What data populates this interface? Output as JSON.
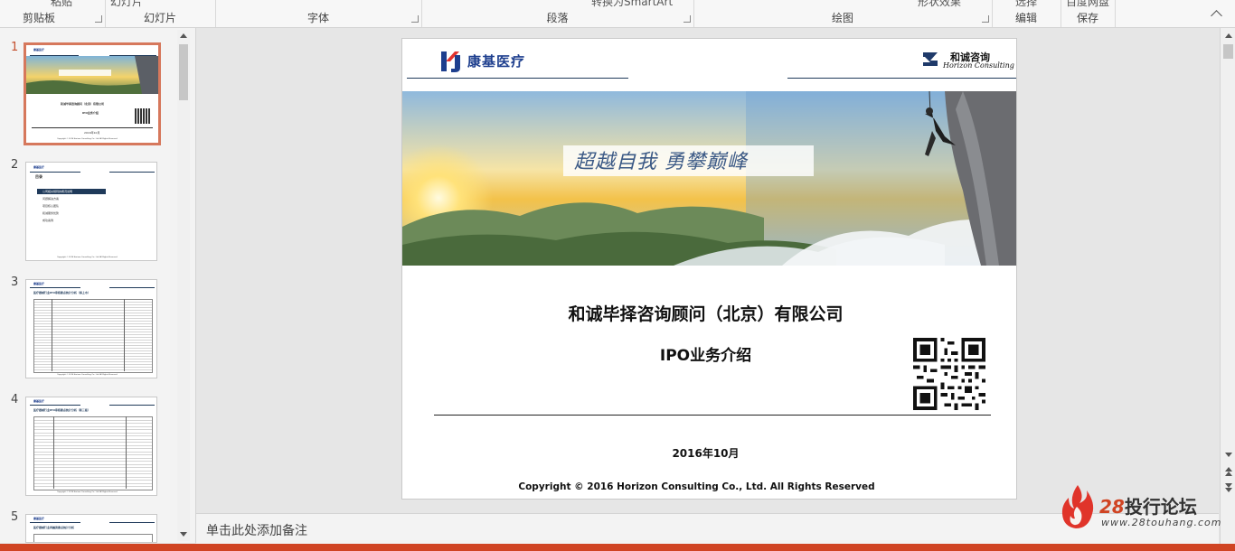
{
  "ribbon": {
    "groups": [
      {
        "label": "剪贴板",
        "cut": "粘贴",
        "launcher": true
      },
      {
        "label": "幻灯片",
        "cut": "幻灯片",
        "launcher": false
      },
      {
        "label": "字体",
        "cut": "",
        "launcher": true
      },
      {
        "label": "段落",
        "cut": "转换为SmartArt",
        "launcher": true
      },
      {
        "label": "绘图",
        "cut": "形状效果",
        "launcher": true
      },
      {
        "label": "编辑",
        "cut": "选择",
        "launcher": false
      },
      {
        "label": "保存",
        "cut": "百度网盘",
        "launcher": false
      }
    ]
  },
  "thumbnails": [
    {
      "number": "1",
      "selected": true
    },
    {
      "number": "2",
      "selected": false
    },
    {
      "number": "3",
      "selected": false
    },
    {
      "number": "4",
      "selected": false
    },
    {
      "number": "5",
      "selected": false
    }
  ],
  "slide": {
    "logo_left": "康基医疗",
    "logo_right_cn": "和诚咨询",
    "logo_right_en": "Horizon Consulting",
    "slogan": "超越自我 勇攀巅峰",
    "company": "和诚毕择咨询顾问（北京）有限公司",
    "subtitle": "IPO业务介绍",
    "date": "2016年10月",
    "copyright": "Copyright © 2016 Horizon Consulting Co., Ltd. All Rights Reserved"
  },
  "mini": {
    "s1_title": "和诚毕择咨询顾问（北京）有限公司",
    "s1_sub": "IPO业务介绍",
    "s1_date": "2016年10月",
    "s2_heading": "目录",
    "s2_items": [
      "公司相关规则的概况说明",
      "问题解决方案",
      "项目核心团队",
      "和诚服务优势",
      "成功案例"
    ],
    "s3_title": "医疗器械行业IPO审核要点统计分析（拟上市）",
    "s4_title": "医疗器械行业IPO审核要点统计分析（新三板）",
    "s5_title": "医疗器械行业再融资要点统计分析"
  },
  "notes": {
    "placeholder": "单击此处添加备注"
  },
  "watermark": {
    "brand": "投行论坛",
    "number": "28",
    "url": "www.28touhang.com"
  }
}
